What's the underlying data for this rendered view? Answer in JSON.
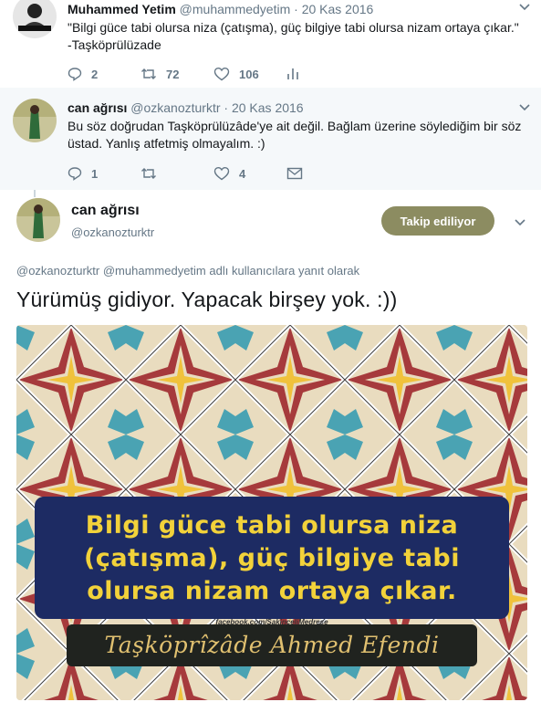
{
  "tweets": [
    {
      "name": "Muhammed Yetim",
      "handle": "@muhammedyetim",
      "separator": "·",
      "date": "20 Kas 2016",
      "line1": "\"Bilgi güce tabi olursa niza (çatışma), güç bilgiye tabi olursa nizam ortaya çıkar.\"",
      "line2": "-Taşköprülüzade",
      "replies": "2",
      "retweets": "72",
      "likes": "106"
    },
    {
      "name": "can ağrısı",
      "handle": "@ozkanozturktr",
      "separator": "·",
      "date": "20 Kas 2016",
      "line1": "Bu söz doğrudan Taşköprülüzâde'ye ait değil. Bağlam üzerine söylediğim bir söz",
      "line2": "üstad. Yanlış atfetmiş olmayalım. :)",
      "replies": "1",
      "retweets": "",
      "likes": "4"
    }
  ],
  "main_tweet": {
    "name": "can ağrısı",
    "handle": "@ozkanozturktr",
    "follow_label": "Takip ediliyor",
    "reply_to_user1": "@ozkanozturktr",
    "reply_to_user2": "@muhammedyetim",
    "reply_to_suffix": "adlı kullanıcılara yanıt olarak",
    "text": "Yürümüş gidiyor. Yapacak birşey yok. :))"
  },
  "media": {
    "quote_lines": [
      "Bilgi güce tabi olursa niza",
      "(çatışma), güç bilgiye tabi",
      "olursa nizam ortaya çıkar."
    ],
    "url": "facebook.com/SakinceliMedrese",
    "author": "Taşköprîzâde Ahmed Efendi"
  },
  "icons": {
    "reply": "reply-icon",
    "retweet": "retweet-icon",
    "like": "heart-icon",
    "analytics": "analytics-icon",
    "message": "envelope-icon",
    "caret": "chevron-down-icon"
  },
  "colors": {
    "follow_button": "#8c8c61",
    "muted": "#657786",
    "quote_box": "#1d2b63",
    "quote_text": "#f2d23a"
  }
}
